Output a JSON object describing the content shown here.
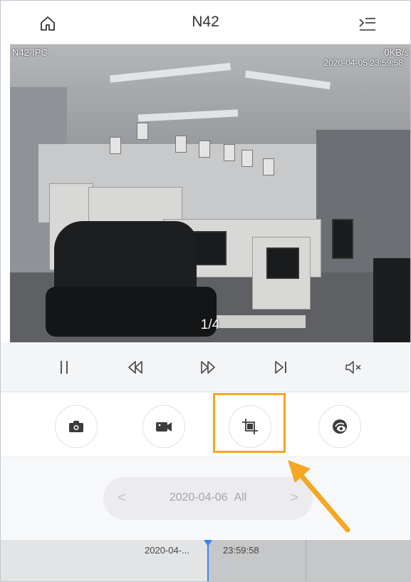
{
  "header": {
    "title": "N42",
    "home_icon": "home-icon",
    "menu_icon": "menu-icon"
  },
  "video": {
    "channel_name": "N42-IPC",
    "bitrate": "0KB/s",
    "timestamp": "2020-04-05 23:59:58",
    "page_counter": "1/4"
  },
  "controls": {
    "icons": [
      "pause-icon",
      "rewind-icon",
      "fast-forward-icon",
      "next-frame-icon",
      "mute-icon"
    ]
  },
  "actions": {
    "icons": [
      "camera-icon",
      "video-record-icon",
      "crop-icon",
      "playback-eye-icon"
    ],
    "highlight_color": "#f5a623"
  },
  "date_selector": {
    "prev": "<",
    "date": "2020-04-06",
    "filter": "All",
    "next": ">"
  },
  "timeline": {
    "left_label": "2020-04-...",
    "right_label": "23:59:58",
    "cursor_color": "#3a86e8"
  },
  "annotation": {
    "arrow_color": "#f5a623"
  }
}
